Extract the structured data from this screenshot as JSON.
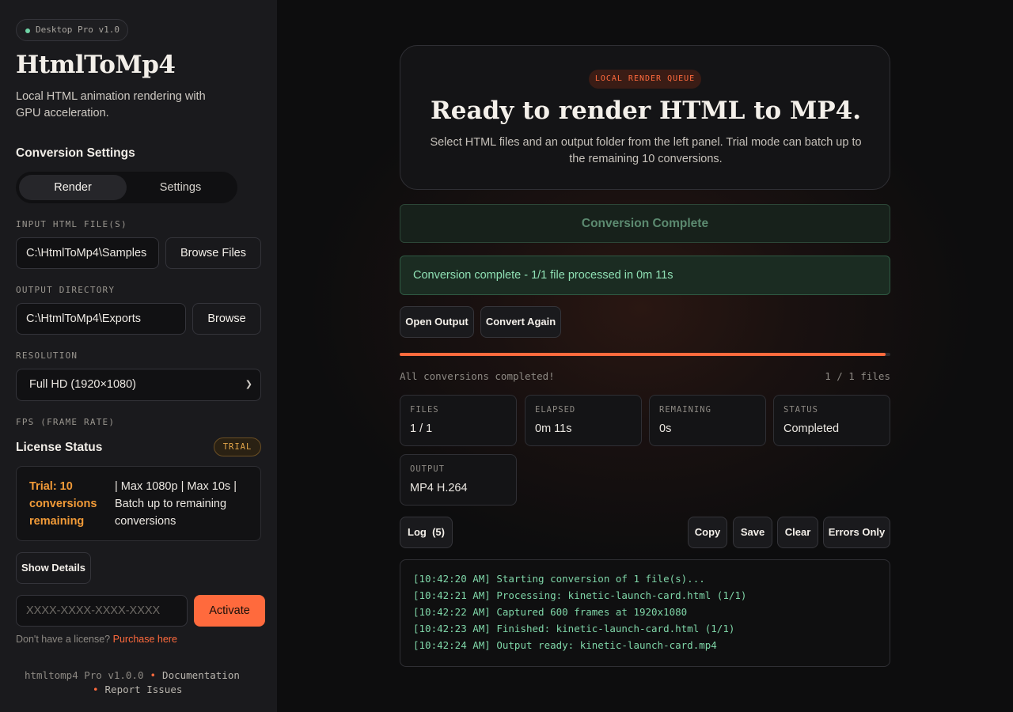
{
  "sidebar": {
    "version": "Desktop Pro v1.0",
    "app_title": "HtmlToMp4",
    "app_subtitle": "Local HTML animation rendering with GPU acceleration.",
    "settings_heading": "Conversion Settings",
    "tabs": [
      {
        "label": "Render",
        "active": true
      },
      {
        "label": "Settings",
        "active": false
      }
    ],
    "input_label": "INPUT HTML FILE(S)",
    "input_value": "C:\\HtmlToMp4\\Samples",
    "browse_files_label": "Browse Files",
    "output_label": "OUTPUT DIRECTORY",
    "output_value": "C:\\HtmlToMp4\\Exports",
    "browse_label": "Browse",
    "resolution_label": "RESOLUTION",
    "resolution_value": "Full HD (1920×1080)",
    "fps_label": "FPS (FRAME RATE)",
    "license_heading": "License Status",
    "license_badge": "TRIAL",
    "license_trial": "Trial: 10 conversions remaining",
    "license_limits": "| Max 1080p | Max 10s | Batch up to remaining conversions",
    "show_details_label": "Show Details",
    "license_placeholder": "XXXX-XXXX-XXXX-XXXX",
    "activate_label": "Activate",
    "no_license_text": "Don't have a license?",
    "purchase_link": "Purchase here",
    "footer_version": "htmltomp4 Pro v1.0.0",
    "footer_docs": "Documentation",
    "footer_issues": "Report Issues"
  },
  "main": {
    "queue_badge": "LOCAL RENDER QUEUE",
    "hero_title": "Ready to render HTML to MP4.",
    "hero_desc": "Select HTML files and an output folder from the left panel. Trial mode can batch up to the remaining 10 conversions.",
    "complete_button": "Conversion Complete",
    "success_message": "Conversion complete - 1/1 file processed in 0m 11s",
    "open_output_label": "Open Output",
    "convert_again_label": "Convert Again",
    "progress_fraction": 0.99,
    "progress_status": "All conversions completed!",
    "progress_count": "1 / 1 files",
    "stats": [
      {
        "label": "FILES",
        "value": "1 / 1"
      },
      {
        "label": "ELAPSED",
        "value": "0m 11s"
      },
      {
        "label": "REMAINING",
        "value": "0s"
      },
      {
        "label": "STATUS",
        "value": "Completed"
      },
      {
        "label": "OUTPUT",
        "value": "MP4 H.264"
      }
    ],
    "log_tab_label": "Log",
    "log_count": "(5)",
    "copy_label": "Copy",
    "save_label": "Save",
    "clear_label": "Clear",
    "errors_only_label": "Errors Only",
    "log_lines": [
      "[10:42:20 AM] Starting conversion of 1 file(s)...",
      "[10:42:21 AM] Processing: kinetic-launch-card.html (1/1)",
      "[10:42:22 AM] Captured 600 frames at 1920x1080",
      "[10:42:23 AM] Finished: kinetic-launch-card.html (1/1)",
      "[10:42:24 AM] Output ready: kinetic-launch-card.mp4"
    ]
  },
  "colors": {
    "accent": "#ff6a3d",
    "success": "#8fe0b4",
    "trial": "#f29b38"
  }
}
